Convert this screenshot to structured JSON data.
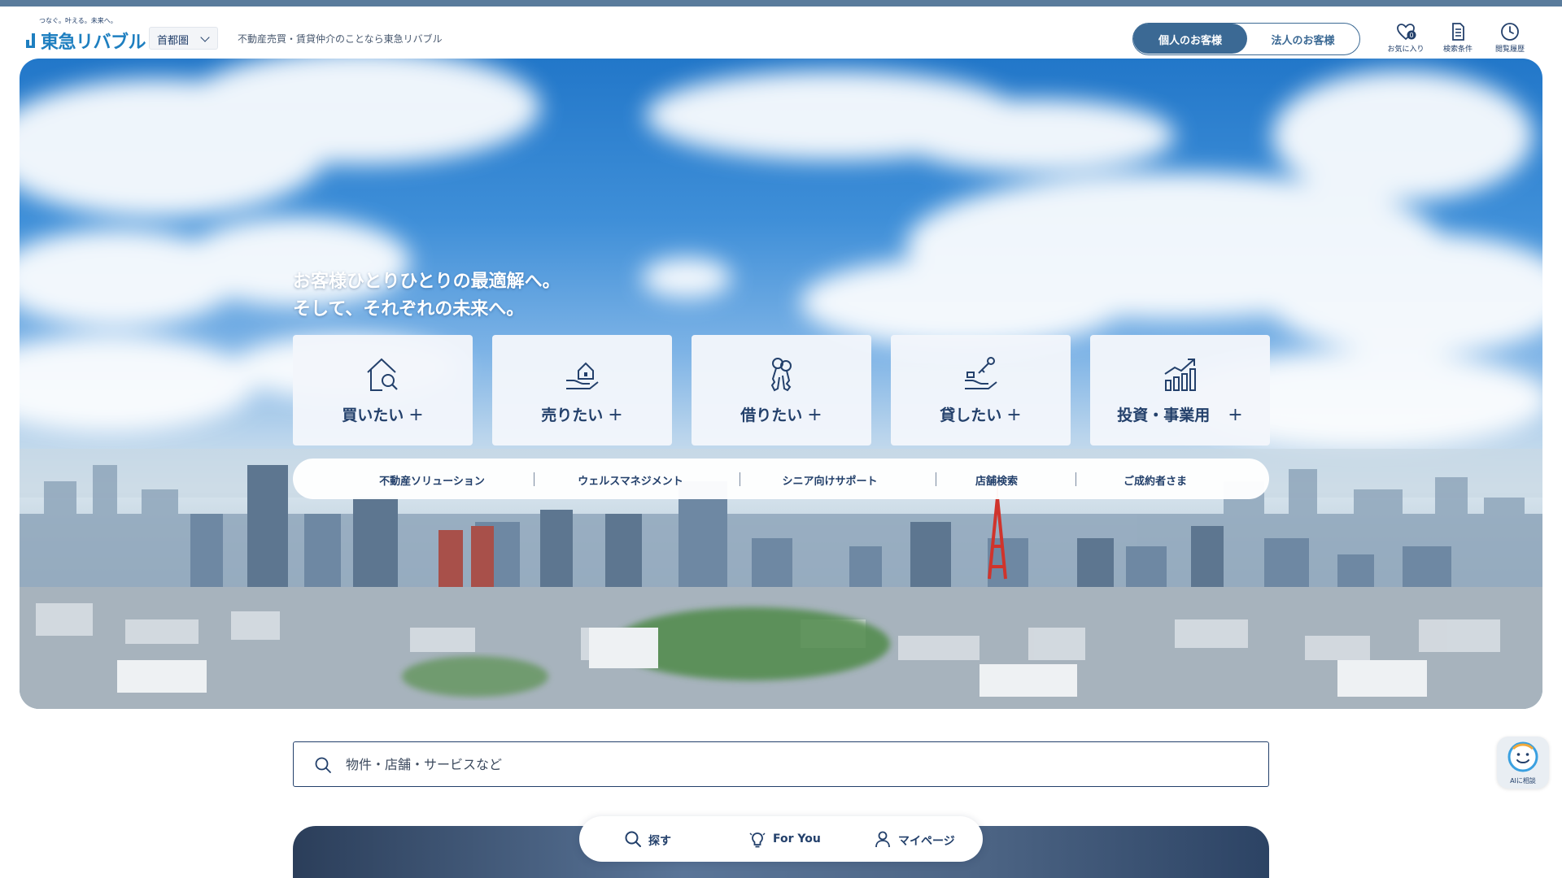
{
  "header": {
    "logo_tagline": "つなぐ。叶える。未来へ。",
    "logo_text": "東急リバブル",
    "region": "首都圏",
    "tagline": "不動産売買・賃貸仲介のことなら東急リバブル",
    "toggle": {
      "personal": "個人のお客様",
      "corporate": "法人のお客様"
    },
    "favorites": {
      "label": "お気に入り",
      "count": "0"
    },
    "search_conditions": {
      "label": "検索条件"
    },
    "history": {
      "label": "閲覧履歴"
    }
  },
  "hero": {
    "headline_1": "お客様ひとりひとりの最適解へ。",
    "headline_2": "そして、それぞれの未来へ。",
    "cards": [
      {
        "label": "買いたい",
        "icon": "house-search-icon"
      },
      {
        "label": "売りたい",
        "icon": "hand-house-icon"
      },
      {
        "label": "借りたい",
        "icon": "keys-icon"
      },
      {
        "label": "貸したい",
        "icon": "hand-key-icon"
      },
      {
        "label": "投資・事業用",
        "icon": "growth-chart-icon"
      }
    ],
    "card_plus": "+",
    "subnav": [
      "不動産ソリューション",
      "ウェルスマネジメント",
      "シニア向けサポート",
      "店舗検索",
      "ご成約者さま"
    ]
  },
  "search": {
    "placeholder": "物件・店舗・サービスなど"
  },
  "bottom_nav": {
    "search": "探す",
    "for_you": "For You",
    "mypage": "マイページ"
  },
  "ai": {
    "label": "AIに相談"
  },
  "colors": {
    "primary": "#23406b",
    "accent": "#3b6994",
    "brand": "#1e7fc0",
    "top_strip": "#5a7c9c"
  }
}
